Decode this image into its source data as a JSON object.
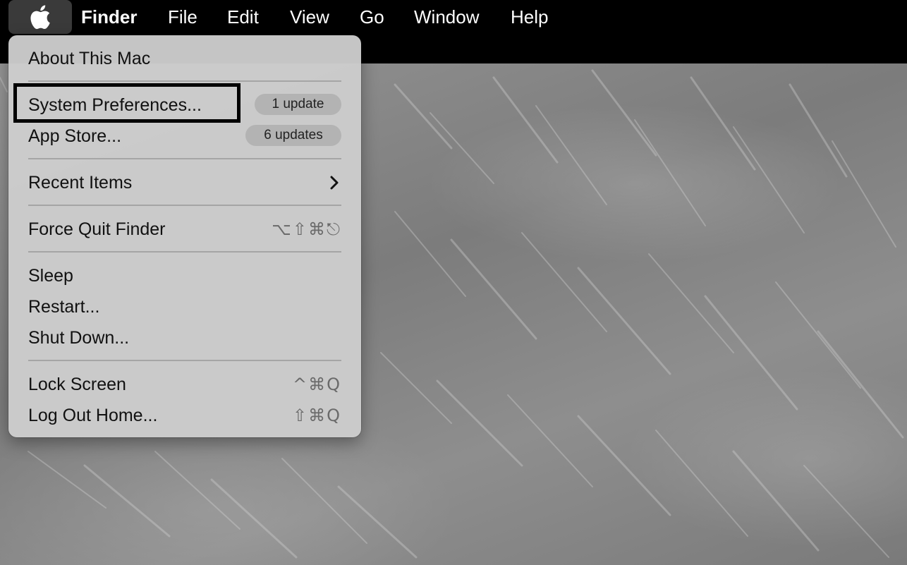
{
  "menubar": {
    "apple_icon": "apple-logo-icon",
    "app_name": "Finder",
    "menus": [
      "File",
      "Edit",
      "View",
      "Go",
      "Window",
      "Help"
    ]
  },
  "apple_menu": {
    "about": "About This Mac",
    "system_preferences": {
      "label": "System Preferences...",
      "badge": "1 update",
      "highlighted": true
    },
    "app_store": {
      "label": "App Store...",
      "badge": "6 updates"
    },
    "recent_items": {
      "label": "Recent Items",
      "icon": "chevron-right-icon"
    },
    "force_quit": {
      "label": "Force Quit Finder",
      "shortcut": "⌥⇧⌘⎋"
    },
    "sleep": "Sleep",
    "restart": "Restart...",
    "shut_down": "Shut Down...",
    "lock_screen": {
      "label": "Lock Screen",
      "shortcut": "^⌘Q"
    },
    "log_out": {
      "label": "Log Out Home...",
      "shortcut": "⇧⌘Q"
    }
  },
  "colors": {
    "menubar": "#000000",
    "menu_background": "#cdcdcd",
    "badge_background": "#b3b3b3",
    "highlight_border": "#000000"
  }
}
